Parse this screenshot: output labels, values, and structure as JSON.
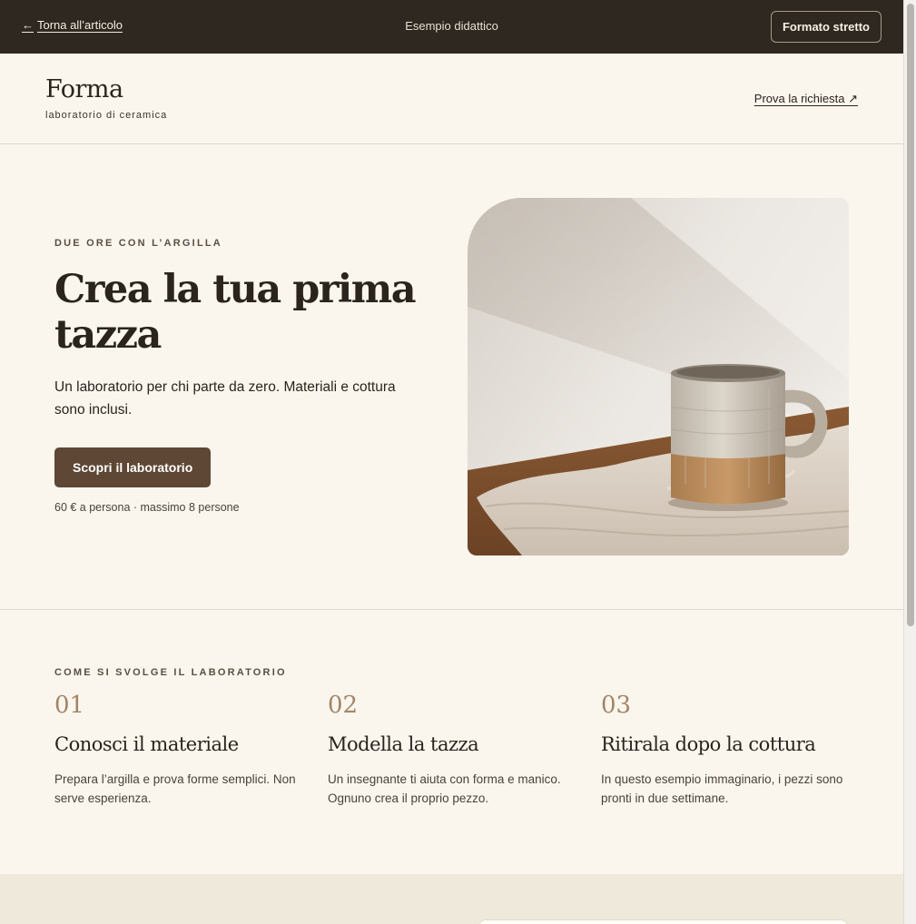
{
  "topbar": {
    "back_label": "Torna all’articolo",
    "center_label": "Esempio didattico",
    "narrow_button": "Formato stretto"
  },
  "header": {
    "logo": "Forma",
    "tagline": "laboratorio di ceramica",
    "try_link": "Prova la richiesta ↗"
  },
  "hero": {
    "eyebrow": "DUE ORE CON L’ARGILLA",
    "title": "Crea la tua prima tazza",
    "description": "Un laboratorio per chi parte da zero. Materiali e cottura sono inclusi.",
    "cta": "Scopri il laboratorio",
    "meta": "60 € a persona · massimo 8 persone"
  },
  "steps": {
    "eyebrow": "COME SI SVOLGE IL LABORATORIO",
    "items": [
      {
        "num": "01",
        "title": "Conosci il materiale",
        "desc": "Prepara l’argilla e prova forme semplici. Non serve esperienza."
      },
      {
        "num": "02",
        "title": "Modella la tazza",
        "desc": "Un insegnante ti aiuta con forma e manico. Ognuno crea il proprio pezzo."
      },
      {
        "num": "03",
        "title": "Ritirala dopo la cottura",
        "desc": "In questo esempio immaginario, i pezzi sono pronti in due settimane."
      }
    ]
  },
  "colors": {
    "topbar_bg": "#2f2820",
    "page_bg": "#faf6ee",
    "accent_button": "#5e4734",
    "step_number": "#a48466",
    "band_bg": "#efe9dc"
  },
  "icons": {
    "back": "arrow-left-icon"
  }
}
